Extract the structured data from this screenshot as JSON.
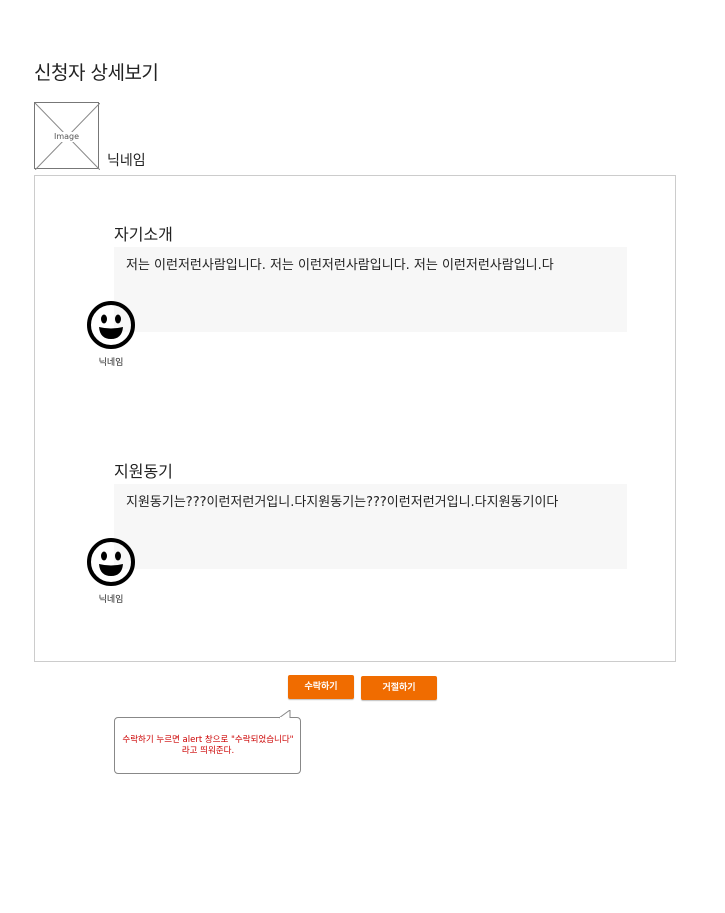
{
  "page": {
    "title": "신청자 상세보기"
  },
  "profile": {
    "image_placeholder": "Image",
    "nickname": "닉네임"
  },
  "sections": [
    {
      "title": "자기소개",
      "content": "저는 이런저런사람입니다. 저는 이런저런사람입니다. 저는 이런저런사람입니.다",
      "avatar_icon": "smiley-icon",
      "avatar_name": "닉네임"
    },
    {
      "title": "지원동기",
      "content": "지원동기는???이런저런거입니.다지원동기는???이런저런거입니.다지원동기이다",
      "avatar_icon": "smiley-icon",
      "avatar_name": "닉네임"
    }
  ],
  "actions": {
    "accept_label": "수락하기",
    "reject_label": "거절하기"
  },
  "annotation": {
    "text": "수락하기 누르면 alert 창으로 \"수락되었습니다\" 라고 띄워준다."
  },
  "colors": {
    "button": "#f06c00",
    "annotation_text": "#cc0000",
    "text_box_bg": "#f7f7f7"
  }
}
